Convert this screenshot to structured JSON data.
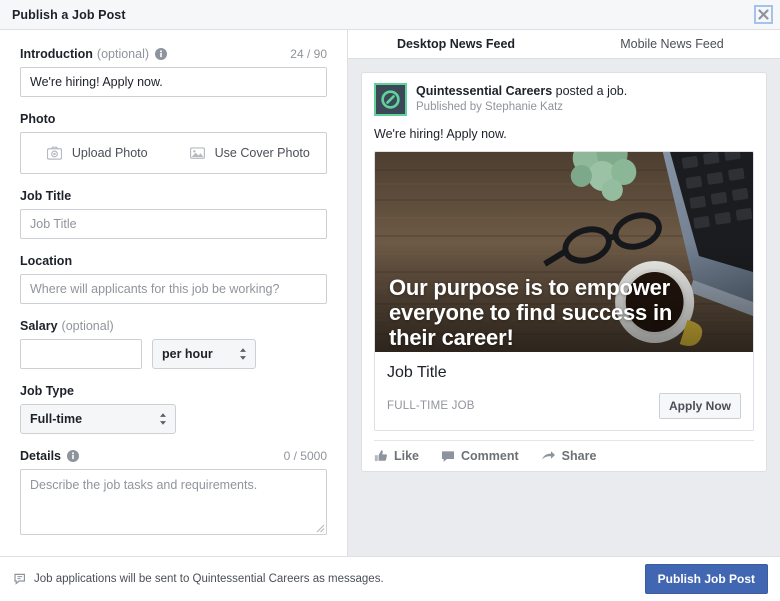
{
  "dialog": {
    "title": "Publish a Job Post",
    "close_icon": "close-icon"
  },
  "form": {
    "introduction": {
      "label": "Introduction",
      "optional": "(optional)",
      "info_icon": "info-icon",
      "counter": "24 / 90",
      "value": "We're hiring! Apply now."
    },
    "photo": {
      "label": "Photo",
      "upload_label": "Upload Photo",
      "upload_icon": "camera-icon",
      "cover_label": "Use Cover Photo",
      "cover_icon": "image-icon"
    },
    "job_title": {
      "label": "Job Title",
      "placeholder": "Job Title",
      "value": ""
    },
    "location": {
      "label": "Location",
      "placeholder": "Where will applicants for this job be working?",
      "value": ""
    },
    "salary": {
      "label": "Salary",
      "optional": "(optional)",
      "value": "",
      "period_selected": "per hour"
    },
    "job_type": {
      "label": "Job Type",
      "selected": "Full-time"
    },
    "details": {
      "label": "Details",
      "info_icon": "info-icon",
      "counter": "0 / 5000",
      "placeholder": "Describe the job tasks and requirements.",
      "value": ""
    }
  },
  "preview": {
    "tabs": [
      {
        "label": "Desktop News Feed",
        "active": true
      },
      {
        "label": "Mobile News Feed",
        "active": false
      }
    ],
    "post": {
      "page_name": "Quintessential Careers",
      "action_text": " posted a job.",
      "published_by": "Published by Stephanie Katz",
      "message": "We're hiring! Apply now.",
      "avatar_icon": "quintessential-q-logo",
      "cover_text": "Our purpose is to empower everyone to find success in their career!",
      "card_title": "Job Title",
      "card_subtitle": "FULL-TIME JOB",
      "apply_label": "Apply Now",
      "actions": [
        {
          "label": "Like",
          "icon": "thumbs-up-icon"
        },
        {
          "label": "Comment",
          "icon": "comment-icon"
        },
        {
          "label": "Share",
          "icon": "share-arrow-icon"
        }
      ]
    }
  },
  "footer": {
    "note": "Job applications will be sent to Quintessential Careers as messages.",
    "note_icon": "messenger-icon",
    "publish_label": "Publish Job Post"
  },
  "colors": {
    "accent_blue": "#4267b2",
    "panel_bg": "#e9ebee",
    "border": "#dddfe2",
    "muted_text": "#90949c",
    "logo_green": "#5fd39a"
  }
}
